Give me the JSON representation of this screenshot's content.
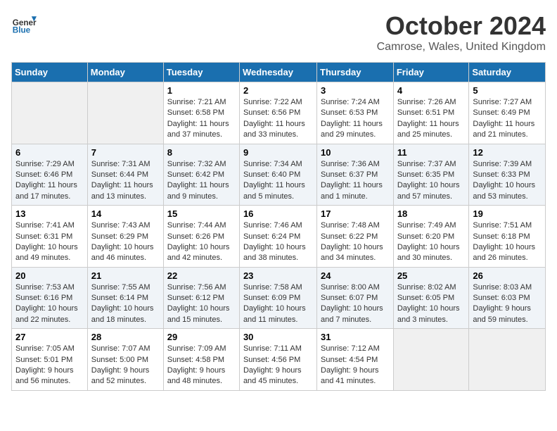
{
  "header": {
    "logo_general": "General",
    "logo_blue": "Blue",
    "month_title": "October 2024",
    "location": "Camrose, Wales, United Kingdom"
  },
  "days_of_week": [
    "Sunday",
    "Monday",
    "Tuesday",
    "Wednesday",
    "Thursday",
    "Friday",
    "Saturday"
  ],
  "weeks": [
    [
      {
        "day": "",
        "sunrise": "",
        "sunset": "",
        "daylight": ""
      },
      {
        "day": "",
        "sunrise": "",
        "sunset": "",
        "daylight": ""
      },
      {
        "day": "1",
        "sunrise": "Sunrise: 7:21 AM",
        "sunset": "Sunset: 6:58 PM",
        "daylight": "Daylight: 11 hours and 37 minutes."
      },
      {
        "day": "2",
        "sunrise": "Sunrise: 7:22 AM",
        "sunset": "Sunset: 6:56 PM",
        "daylight": "Daylight: 11 hours and 33 minutes."
      },
      {
        "day": "3",
        "sunrise": "Sunrise: 7:24 AM",
        "sunset": "Sunset: 6:53 PM",
        "daylight": "Daylight: 11 hours and 29 minutes."
      },
      {
        "day": "4",
        "sunrise": "Sunrise: 7:26 AM",
        "sunset": "Sunset: 6:51 PM",
        "daylight": "Daylight: 11 hours and 25 minutes."
      },
      {
        "day": "5",
        "sunrise": "Sunrise: 7:27 AM",
        "sunset": "Sunset: 6:49 PM",
        "daylight": "Daylight: 11 hours and 21 minutes."
      }
    ],
    [
      {
        "day": "6",
        "sunrise": "Sunrise: 7:29 AM",
        "sunset": "Sunset: 6:46 PM",
        "daylight": "Daylight: 11 hours and 17 minutes."
      },
      {
        "day": "7",
        "sunrise": "Sunrise: 7:31 AM",
        "sunset": "Sunset: 6:44 PM",
        "daylight": "Daylight: 11 hours and 13 minutes."
      },
      {
        "day": "8",
        "sunrise": "Sunrise: 7:32 AM",
        "sunset": "Sunset: 6:42 PM",
        "daylight": "Daylight: 11 hours and 9 minutes."
      },
      {
        "day": "9",
        "sunrise": "Sunrise: 7:34 AM",
        "sunset": "Sunset: 6:40 PM",
        "daylight": "Daylight: 11 hours and 5 minutes."
      },
      {
        "day": "10",
        "sunrise": "Sunrise: 7:36 AM",
        "sunset": "Sunset: 6:37 PM",
        "daylight": "Daylight: 11 hours and 1 minute."
      },
      {
        "day": "11",
        "sunrise": "Sunrise: 7:37 AM",
        "sunset": "Sunset: 6:35 PM",
        "daylight": "Daylight: 10 hours and 57 minutes."
      },
      {
        "day": "12",
        "sunrise": "Sunrise: 7:39 AM",
        "sunset": "Sunset: 6:33 PM",
        "daylight": "Daylight: 10 hours and 53 minutes."
      }
    ],
    [
      {
        "day": "13",
        "sunrise": "Sunrise: 7:41 AM",
        "sunset": "Sunset: 6:31 PM",
        "daylight": "Daylight: 10 hours and 49 minutes."
      },
      {
        "day": "14",
        "sunrise": "Sunrise: 7:43 AM",
        "sunset": "Sunset: 6:29 PM",
        "daylight": "Daylight: 10 hours and 46 minutes."
      },
      {
        "day": "15",
        "sunrise": "Sunrise: 7:44 AM",
        "sunset": "Sunset: 6:26 PM",
        "daylight": "Daylight: 10 hours and 42 minutes."
      },
      {
        "day": "16",
        "sunrise": "Sunrise: 7:46 AM",
        "sunset": "Sunset: 6:24 PM",
        "daylight": "Daylight: 10 hours and 38 minutes."
      },
      {
        "day": "17",
        "sunrise": "Sunrise: 7:48 AM",
        "sunset": "Sunset: 6:22 PM",
        "daylight": "Daylight: 10 hours and 34 minutes."
      },
      {
        "day": "18",
        "sunrise": "Sunrise: 7:49 AM",
        "sunset": "Sunset: 6:20 PM",
        "daylight": "Daylight: 10 hours and 30 minutes."
      },
      {
        "day": "19",
        "sunrise": "Sunrise: 7:51 AM",
        "sunset": "Sunset: 6:18 PM",
        "daylight": "Daylight: 10 hours and 26 minutes."
      }
    ],
    [
      {
        "day": "20",
        "sunrise": "Sunrise: 7:53 AM",
        "sunset": "Sunset: 6:16 PM",
        "daylight": "Daylight: 10 hours and 22 minutes."
      },
      {
        "day": "21",
        "sunrise": "Sunrise: 7:55 AM",
        "sunset": "Sunset: 6:14 PM",
        "daylight": "Daylight: 10 hours and 18 minutes."
      },
      {
        "day": "22",
        "sunrise": "Sunrise: 7:56 AM",
        "sunset": "Sunset: 6:12 PM",
        "daylight": "Daylight: 10 hours and 15 minutes."
      },
      {
        "day": "23",
        "sunrise": "Sunrise: 7:58 AM",
        "sunset": "Sunset: 6:09 PM",
        "daylight": "Daylight: 10 hours and 11 minutes."
      },
      {
        "day": "24",
        "sunrise": "Sunrise: 8:00 AM",
        "sunset": "Sunset: 6:07 PM",
        "daylight": "Daylight: 10 hours and 7 minutes."
      },
      {
        "day": "25",
        "sunrise": "Sunrise: 8:02 AM",
        "sunset": "Sunset: 6:05 PM",
        "daylight": "Daylight: 10 hours and 3 minutes."
      },
      {
        "day": "26",
        "sunrise": "Sunrise: 8:03 AM",
        "sunset": "Sunset: 6:03 PM",
        "daylight": "Daylight: 9 hours and 59 minutes."
      }
    ],
    [
      {
        "day": "27",
        "sunrise": "Sunrise: 7:05 AM",
        "sunset": "Sunset: 5:01 PM",
        "daylight": "Daylight: 9 hours and 56 minutes."
      },
      {
        "day": "28",
        "sunrise": "Sunrise: 7:07 AM",
        "sunset": "Sunset: 5:00 PM",
        "daylight": "Daylight: 9 hours and 52 minutes."
      },
      {
        "day": "29",
        "sunrise": "Sunrise: 7:09 AM",
        "sunset": "Sunset: 4:58 PM",
        "daylight": "Daylight: 9 hours and 48 minutes."
      },
      {
        "day": "30",
        "sunrise": "Sunrise: 7:11 AM",
        "sunset": "Sunset: 4:56 PM",
        "daylight": "Daylight: 9 hours and 45 minutes."
      },
      {
        "day": "31",
        "sunrise": "Sunrise: 7:12 AM",
        "sunset": "Sunset: 4:54 PM",
        "daylight": "Daylight: 9 hours and 41 minutes."
      },
      {
        "day": "",
        "sunrise": "",
        "sunset": "",
        "daylight": ""
      },
      {
        "day": "",
        "sunrise": "",
        "sunset": "",
        "daylight": ""
      }
    ]
  ]
}
